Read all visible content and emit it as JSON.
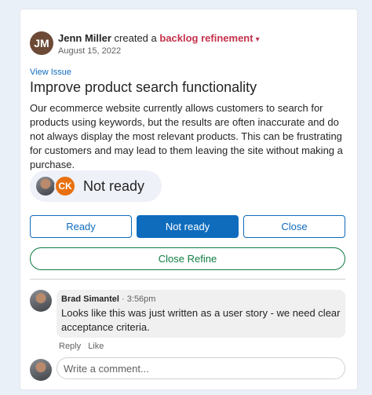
{
  "post": {
    "author_initials": "JM",
    "author": "Jenn Miller",
    "action_text": "created a",
    "type": "backlog refinement",
    "caret": "▾",
    "date": "August 15, 2022",
    "view_issue": "View Issue",
    "title": "Improve product search functionality",
    "description": "Our ecommerce website currently allows customers to search for products using keywords, but the results are often inaccurate and do not always display the most relevant products. This can be frustrating for customers and may lead to them leaving the site without making a purchase."
  },
  "status": {
    "voter_initials": "CK",
    "label": "Not ready"
  },
  "buttons": {
    "ready": "Ready",
    "not_ready": "Not ready",
    "close": "Close",
    "close_refine": "Close Refine"
  },
  "comment": {
    "author": "Brad Simantel",
    "separator": "·",
    "time": "3:56pm",
    "text": "Looks like this was just written as a user story - we need clear acceptance criteria.",
    "reply": "Reply",
    "like": "Like"
  },
  "composer": {
    "placeholder": "Write a comment..."
  },
  "colors": {
    "accent": "#0f6cbd",
    "type_link": "#c4314b",
    "refine_green": "#107c41",
    "ck_avatar": "#e8700e"
  }
}
